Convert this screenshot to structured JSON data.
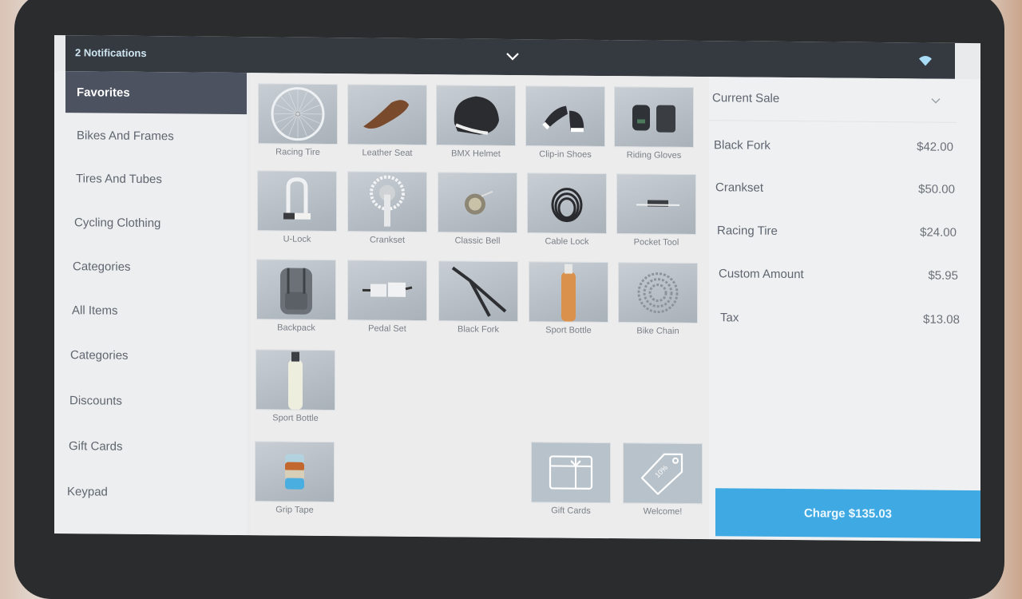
{
  "topbar": {
    "notifications": "2 Notifications",
    "expand_icon": "chevron-down-icon",
    "wifi_icon": "wifi-icon"
  },
  "sidebar": {
    "items": [
      {
        "label": "Favorites",
        "active": true
      },
      {
        "label": "Bikes And Frames"
      },
      {
        "label": "Tires And Tubes"
      },
      {
        "label": "Cycling Clothing"
      },
      {
        "label": "Categories"
      },
      {
        "label": "All Items"
      },
      {
        "label": "Categories"
      },
      {
        "label": "Discounts"
      },
      {
        "label": "Gift Cards"
      },
      {
        "label": "Keypad"
      }
    ]
  },
  "items": [
    {
      "label": "Racing Tire",
      "icon": "wheel"
    },
    {
      "label": "Leather Seat",
      "icon": "seat"
    },
    {
      "label": "BMX Helmet",
      "icon": "helmet"
    },
    {
      "label": "Clip-in Shoes",
      "icon": "shoes"
    },
    {
      "label": "Riding Gloves",
      "icon": "gloves"
    },
    {
      "label": "U-Lock",
      "icon": "ulock"
    },
    {
      "label": "Crankset",
      "icon": "crank"
    },
    {
      "label": "Classic Bell",
      "icon": "bell"
    },
    {
      "label": "Cable Lock",
      "icon": "cable"
    },
    {
      "label": "Pocket Tool",
      "icon": "tool"
    },
    {
      "label": "Backpack",
      "icon": "backpack"
    },
    {
      "label": "Pedal Set",
      "icon": "pedal"
    },
    {
      "label": "Black Fork",
      "icon": "fork"
    },
    {
      "label": "Sport Bottle",
      "icon": "bottle-orange"
    },
    {
      "label": "Bike Chain",
      "icon": "chain"
    },
    {
      "label": "Sport Bottle",
      "icon": "bottle-white"
    },
    {
      "label": "Grip Tape",
      "icon": "tape"
    },
    {
      "label": "Gift Cards",
      "icon": "gift-card"
    },
    {
      "label": "Welcome!",
      "icon": "discount-tag"
    }
  ],
  "sale": {
    "title": "Current Sale",
    "lines": [
      {
        "name": "Black Fork",
        "amount": "$42.00"
      },
      {
        "name": "Crankset",
        "amount": "$50.00"
      },
      {
        "name": "Racing Tire",
        "amount": "$24.00"
      },
      {
        "name": "Custom Amount",
        "amount": "$5.95"
      },
      {
        "name": "Tax",
        "amount": "$13.08"
      }
    ],
    "charge_label": "Charge $135.03"
  },
  "colors": {
    "charge": "#3fa9e3",
    "topbar": "#353a41",
    "active_sidebar": "#4d5260"
  }
}
